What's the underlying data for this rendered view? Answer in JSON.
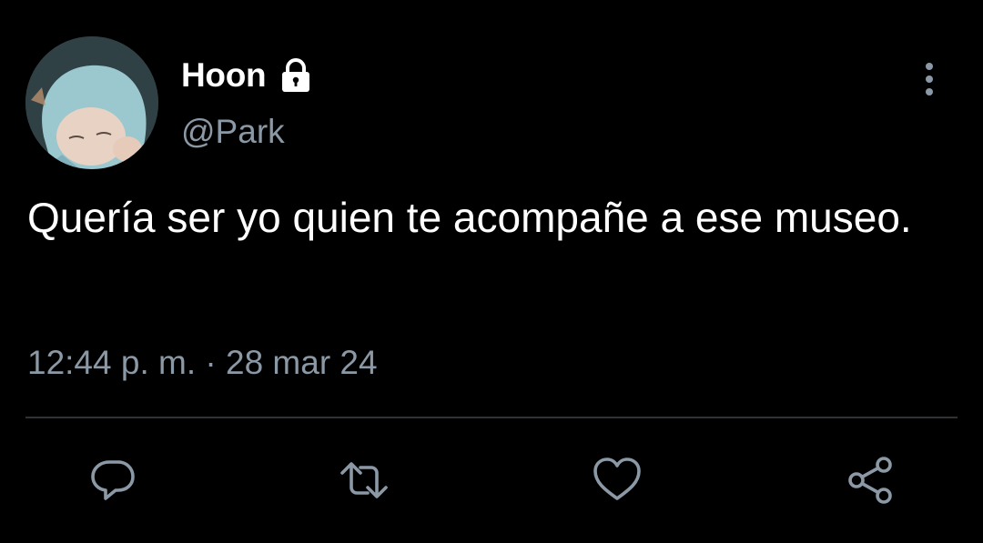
{
  "tweet": {
    "display_name": "Hoon",
    "handle": "@Park",
    "text": "Quería ser yo quien te acompañe a ese museo.",
    "time": "12:44 p. m.",
    "separator": "·",
    "date": "28 mar 24",
    "protected": true
  },
  "icons": {
    "lock": "lock-icon",
    "more": "more-vertical-icon",
    "reply": "reply-icon",
    "retweet": "retweet-icon",
    "like": "heart-icon",
    "share": "share-icon"
  },
  "colors": {
    "background": "#000000",
    "text_primary": "#ffffff",
    "text_secondary": "#8b98a5",
    "divider": "#2f3336"
  }
}
